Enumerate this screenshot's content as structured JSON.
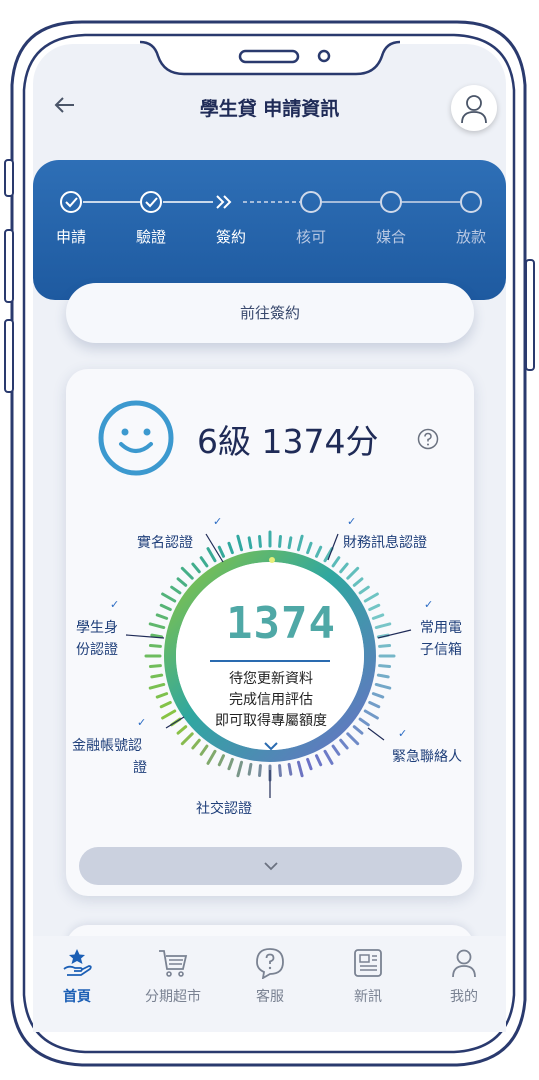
{
  "header": {
    "title": "學生貸 申請資訊"
  },
  "steps": [
    {
      "label": "申請",
      "state": "done"
    },
    {
      "label": "驗證",
      "state": "done"
    },
    {
      "label": "簽約",
      "state": "current"
    },
    {
      "label": "核可",
      "state": "pending"
    },
    {
      "label": "媒合",
      "state": "pending"
    },
    {
      "label": "放款",
      "state": "pending"
    }
  ],
  "go_sign_label": "前往簽約",
  "score": {
    "grade_text": "6級 1374分",
    "value": "1374",
    "message": [
      "待您更新資料",
      "完成信用評估",
      "即可取得專屬額度"
    ]
  },
  "items": {
    "real_name": "實名認證",
    "financial": "財務訊息認證",
    "student_1": "學生身",
    "student_2": "份認證",
    "email_1": "常用電",
    "email_2": "子信箱",
    "bank_1": "金融帳號認",
    "bank_2": "證",
    "contact": "緊急聯絡人",
    "social": "社交認證",
    "check": "✓"
  },
  "tabs": [
    {
      "label": "首頁",
      "icon": "home-star-icon",
      "active": true
    },
    {
      "label": "分期超市",
      "icon": "cart-icon",
      "active": false
    },
    {
      "label": "客服",
      "icon": "help-bubble-icon",
      "active": false
    },
    {
      "label": "新訊",
      "icon": "news-icon",
      "active": false
    },
    {
      "label": "我的",
      "icon": "person-icon",
      "active": false
    }
  ],
  "colors": {
    "brand": "#2168b3",
    "navy": "#1f2b57",
    "teal": "#4fa8a6",
    "active_tab": "#1c5fb5"
  }
}
